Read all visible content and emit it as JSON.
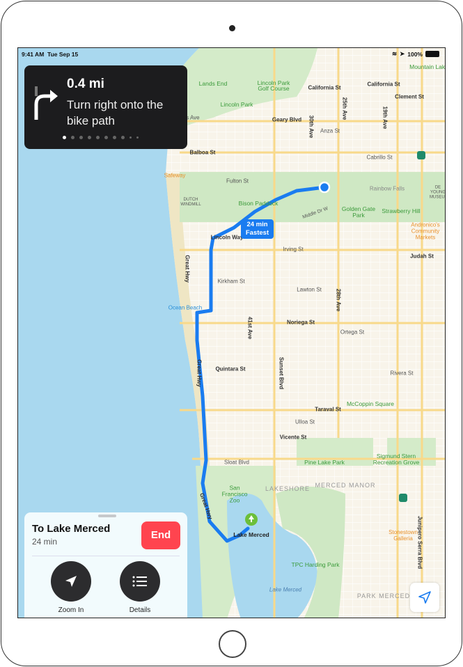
{
  "status_bar": {
    "time": "9:41 AM",
    "date": "Tue Sep 15",
    "battery": "100%"
  },
  "navigation": {
    "distance": "0.4 mi",
    "instruction": "Turn right onto the bike path",
    "maneuver_icon": "turn-right-arrow",
    "step_index": 1,
    "step_count": 10
  },
  "route": {
    "eta_time": "24 min",
    "eta_label": "Fastest",
    "color": "#1a7cf0"
  },
  "map_labels": {
    "parks": [
      "Lands End",
      "Lincoln Park Golf Course",
      "Lincoln Park",
      "Bison Paddock",
      "Golden Gate Park",
      "Strawberry Hill",
      "McCoppin Square",
      "Pine Lake Park",
      "Sigmund Stern Recreation Grove",
      "San Francisco Zoo",
      "TPC Harding Park",
      "Mountain Lake"
    ],
    "streets": [
      "California St",
      "California St",
      "Clement St",
      "Lobos Ave",
      "Geary Blvd",
      "Anza St",
      "Balboa St",
      "Cabrillo St",
      "Fulton St",
      "Middle Dr W",
      "Lincoln Way",
      "Irving St",
      "Judah St",
      "Kirkham St",
      "Lawton St",
      "Noriega St",
      "Ortega St",
      "Quintara St",
      "Rivera St",
      "Taraval St",
      "Ulloa St",
      "Vicente St",
      "Sloat Blvd"
    ],
    "avenues": [
      "Great Hwy",
      "Great Hwy",
      "41st Ave",
      "Sunset Blvd",
      "28th Ave",
      "19th Ave",
      "25th Ave",
      "30th Ave",
      "Junipero Serra Blvd",
      "Great Hwy"
    ],
    "areas": [
      "LAKESHORE",
      "MERCED MANOR",
      "PARK MERCED"
    ],
    "pois": [
      "Rainbow Falls",
      "Andronico's Community Markets",
      "Stonestown Galleria",
      "Safeway",
      "Ocean Beach",
      "DUTCH WINDMILL",
      "DE YOUNG MUSEUM"
    ],
    "water": [
      "Lake Merced"
    ],
    "destination": "Lake Merced"
  },
  "trip_sheet": {
    "title": "To Lake Merced",
    "duration": "24 min",
    "end_label": "End",
    "zoom_in_label": "Zoom In",
    "details_label": "Details"
  }
}
